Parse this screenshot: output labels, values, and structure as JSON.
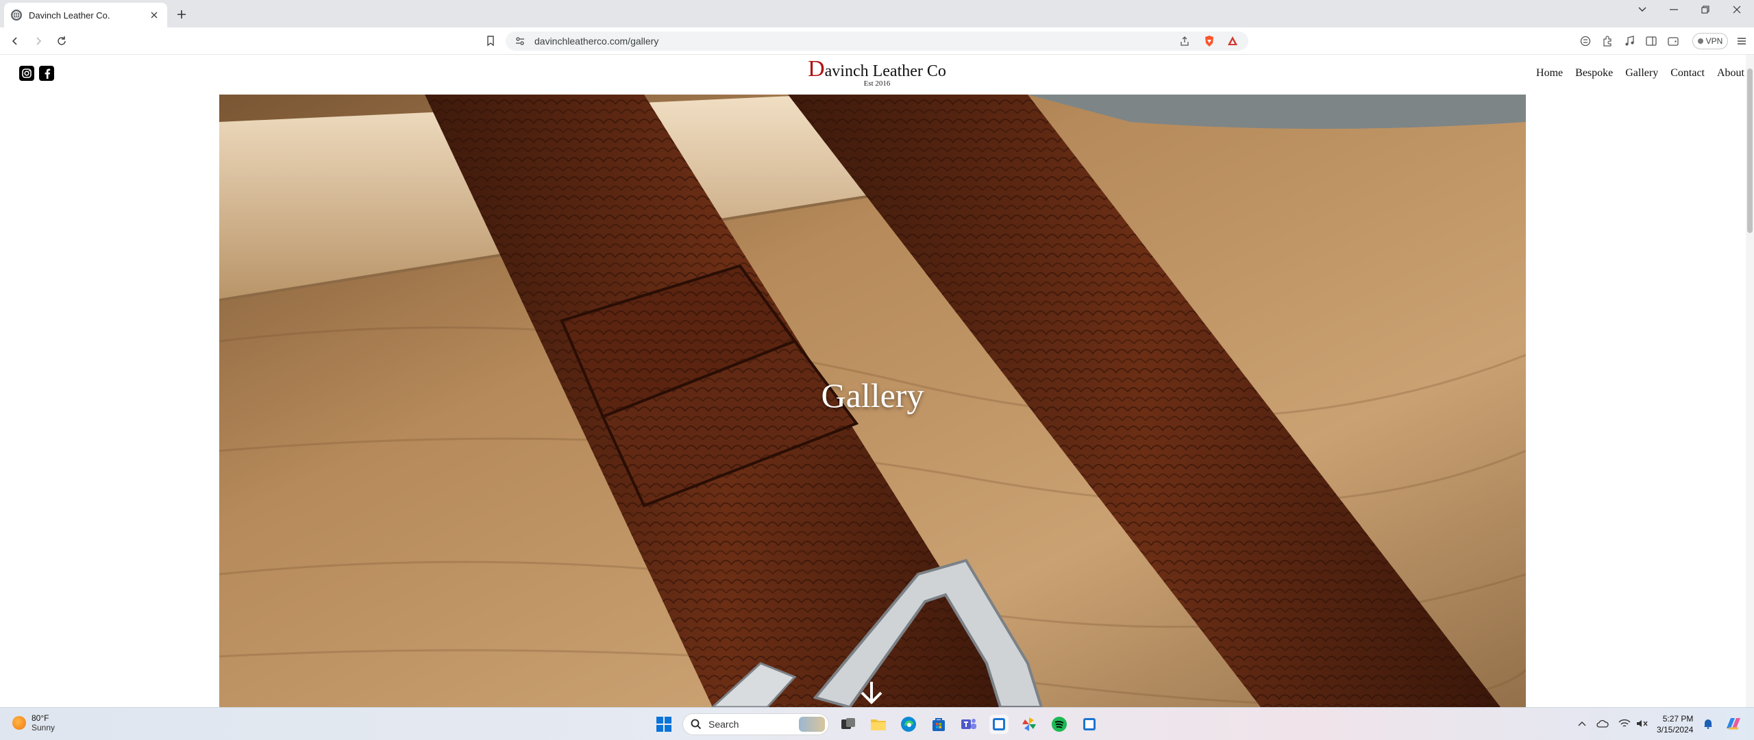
{
  "browser": {
    "tab_title": "Davinch Leather Co.",
    "url": "davinchleatherco.com/gallery",
    "vpn_label": "VPN"
  },
  "site": {
    "brand_initial": "D",
    "brand_rest": "avinch Leather Co",
    "established": "Est 2016",
    "nav": [
      "Home",
      "Bespoke",
      "Gallery",
      "Contact",
      "About"
    ]
  },
  "hero": {
    "title": "Gallery"
  },
  "taskbar": {
    "temperature": "80°F",
    "condition": "Sunny",
    "search_label": "Search",
    "time": "5:27 PM",
    "date": "3/15/2024"
  }
}
